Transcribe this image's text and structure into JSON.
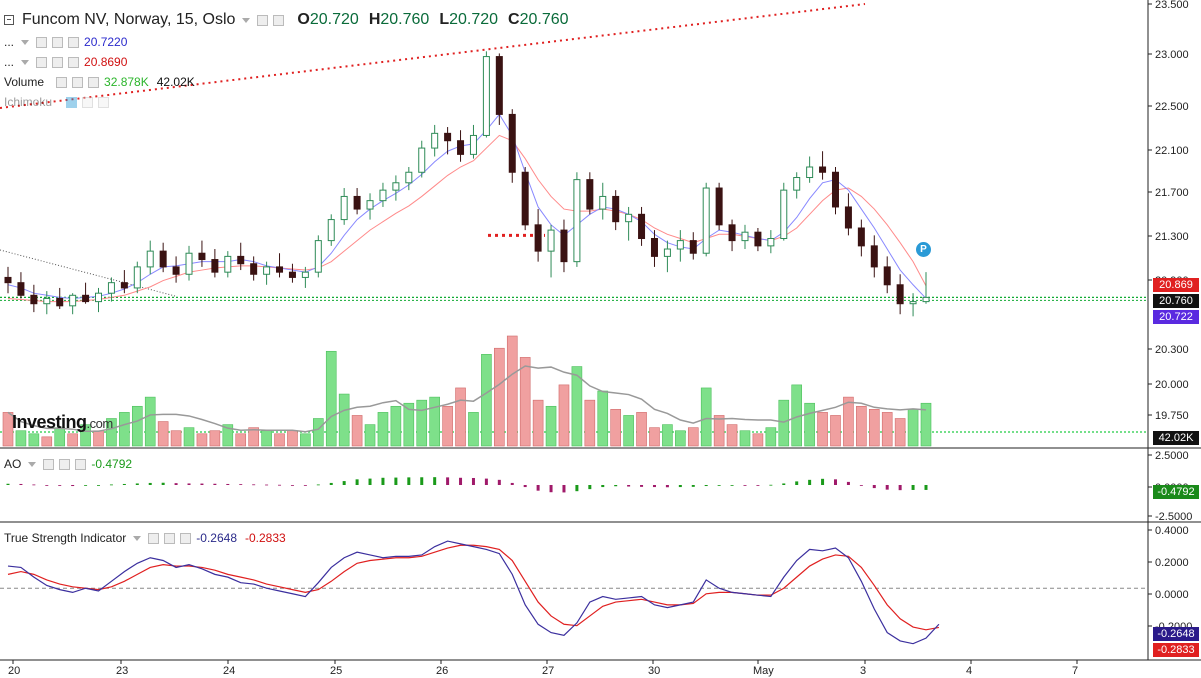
{
  "header": {
    "symbol": "Funcom NV, Norway, 15, Oslo",
    "open_label": "O",
    "open": "20.720",
    "high_label": "H",
    "high": "20.760",
    "low_label": "L",
    "low": "20.720",
    "close_label": "C",
    "close": "20.760"
  },
  "legend": {
    "ma1_name": "...",
    "ma1_value": "20.7220",
    "ma2_name": "...",
    "ma2_value": "20.8690",
    "volume_name": "Volume",
    "volume_value1": "32.878K",
    "volume_value2": "42.02K",
    "ichimoku_name": "Ichimoku",
    "ao_name": "AO",
    "ao_value": "-0.4792",
    "tsi_name": "True Strength Indicator",
    "tsi_value1": "-0.2648",
    "tsi_value2": "-0.2833"
  },
  "logo": {
    "text": "Investing",
    "suffix": ".com"
  },
  "marker": {
    "label": "P"
  },
  "price_tags": {
    "ma2": "20.869",
    "close": "20.760",
    "ma1": "20.722",
    "volume": "42.02K",
    "ao": "-0.4792",
    "tsi1": "-0.2648",
    "tsi2": "-0.2833"
  },
  "colors": {
    "up": "#2e8b57",
    "down": "#3a1212",
    "vol_up": "#7ee08a",
    "vol_down": "#f0a0a0",
    "ma_fast": "#8888ff",
    "ma_slow": "#ff8a8a",
    "tsi": "#3b2f9e",
    "tsi_signal": "#e02020",
    "ichimoku": "#e02020",
    "ao_up": "#1a9a1a",
    "ao_down": "#a01a6a"
  },
  "chart_data": [
    {
      "type": "candlestick",
      "title": "Funcom NV, Norway, 15, Oslo",
      "y_ticks": [
        "23.500",
        "23.000",
        "22.500",
        "22.100",
        "21.700",
        "21.300",
        "20.900",
        "20.300",
        "20.000",
        "19.750"
      ],
      "x_ticks": [
        "20",
        "23",
        "24",
        "25",
        "26",
        "27",
        "30",
        "May",
        "3",
        "4",
        "7"
      ],
      "ylim": [
        20.45,
        23.55
      ],
      "candles": [
        [
          20.95,
          21.05,
          20.8,
          20.9
        ],
        [
          20.9,
          21.0,
          20.75,
          20.78
        ],
        [
          20.78,
          20.88,
          20.62,
          20.7
        ],
        [
          20.7,
          20.82,
          20.6,
          20.75
        ],
        [
          20.75,
          20.85,
          20.65,
          20.68
        ],
        [
          20.68,
          20.8,
          20.6,
          20.78
        ],
        [
          20.78,
          20.9,
          20.7,
          20.72
        ],
        [
          20.72,
          20.85,
          20.62,
          20.8
        ],
        [
          20.8,
          20.95,
          20.72,
          20.9
        ],
        [
          20.9,
          21.02,
          20.8,
          20.85
        ],
        [
          20.85,
          21.1,
          20.8,
          21.05
        ],
        [
          21.05,
          21.3,
          20.98,
          21.2
        ],
        [
          21.2,
          21.28,
          21.0,
          21.05
        ],
        [
          21.05,
          21.15,
          20.9,
          20.98
        ],
        [
          20.98,
          21.25,
          20.92,
          21.18
        ],
        [
          21.18,
          21.3,
          21.05,
          21.12
        ],
        [
          21.12,
          21.22,
          20.95,
          21.0
        ],
        [
          21.0,
          21.2,
          20.95,
          21.15
        ],
        [
          21.15,
          21.28,
          21.02,
          21.08
        ],
        [
          21.08,
          21.15,
          20.92,
          20.98
        ],
        [
          20.98,
          21.1,
          20.88,
          21.05
        ],
        [
          21.05,
          21.18,
          20.95,
          21.0
        ],
        [
          21.0,
          21.08,
          20.9,
          20.95
        ],
        [
          20.95,
          21.05,
          20.85,
          21.0
        ],
        [
          21.0,
          21.35,
          20.95,
          21.3
        ],
        [
          21.3,
          21.55,
          21.25,
          21.5
        ],
        [
          21.5,
          21.8,
          21.45,
          21.72
        ],
        [
          21.72,
          21.8,
          21.55,
          21.6
        ],
        [
          21.6,
          21.75,
          21.5,
          21.68
        ],
        [
          21.68,
          21.85,
          21.62,
          21.78
        ],
        [
          21.78,
          21.92,
          21.68,
          21.85
        ],
        [
          21.85,
          22.0,
          21.78,
          21.95
        ],
        [
          21.95,
          22.25,
          21.9,
          22.18
        ],
        [
          22.18,
          22.4,
          22.1,
          22.32
        ],
        [
          22.32,
          22.38,
          22.12,
          22.25
        ],
        [
          22.25,
          22.35,
          22.05,
          22.12
        ],
        [
          22.12,
          22.4,
          22.08,
          22.3
        ],
        [
          22.3,
          23.1,
          22.28,
          23.05
        ],
        [
          23.05,
          23.08,
          22.4,
          22.5
        ],
        [
          22.5,
          22.55,
          21.85,
          21.95
        ],
        [
          21.95,
          22.0,
          21.4,
          21.45
        ],
        [
          21.45,
          21.6,
          21.1,
          21.2
        ],
        [
          21.2,
          21.45,
          20.95,
          21.4
        ],
        [
          21.4,
          21.5,
          21.0,
          21.1
        ],
        [
          21.1,
          21.95,
          21.05,
          21.88
        ],
        [
          21.88,
          21.95,
          21.55,
          21.6
        ],
        [
          21.6,
          21.85,
          21.5,
          21.72
        ],
        [
          21.72,
          21.78,
          21.4,
          21.48
        ],
        [
          21.48,
          21.62,
          21.3,
          21.55
        ],
        [
          21.55,
          21.62,
          21.25,
          21.32
        ],
        [
          21.32,
          21.4,
          21.05,
          21.15
        ],
        [
          21.15,
          21.3,
          21.0,
          21.22
        ],
        [
          21.22,
          21.4,
          21.1,
          21.3
        ],
        [
          21.3,
          21.38,
          21.12,
          21.18
        ],
        [
          21.18,
          21.85,
          21.15,
          21.8
        ],
        [
          21.8,
          21.85,
          21.4,
          21.45
        ],
        [
          21.45,
          21.5,
          21.2,
          21.3
        ],
        [
          21.3,
          21.45,
          21.22,
          21.38
        ],
        [
          21.38,
          21.42,
          21.2,
          21.25
        ],
        [
          21.25,
          21.4,
          21.18,
          21.32
        ],
        [
          21.32,
          21.85,
          21.3,
          21.78
        ],
        [
          21.78,
          21.95,
          21.7,
          21.9
        ],
        [
          21.9,
          22.1,
          21.85,
          22.0
        ],
        [
          22.0,
          22.15,
          21.88,
          21.95
        ],
        [
          21.95,
          22.0,
          21.55,
          21.62
        ],
        [
          21.62,
          21.75,
          21.35,
          21.42
        ],
        [
          21.42,
          21.5,
          21.15,
          21.25
        ],
        [
          21.25,
          21.35,
          20.95,
          21.05
        ],
        [
          21.05,
          21.15,
          20.8,
          20.88
        ],
        [
          20.88,
          20.98,
          20.6,
          20.7
        ],
        [
          20.7,
          20.8,
          20.58,
          20.72
        ],
        [
          20.72,
          21.0,
          20.7,
          20.76
        ]
      ],
      "ma_fast": [
        20.88,
        20.85,
        20.8,
        20.78,
        20.76,
        20.75,
        20.76,
        20.77,
        20.8,
        20.84,
        20.9,
        20.98,
        21.05,
        21.06,
        21.08,
        21.1,
        21.1,
        21.1,
        21.12,
        21.1,
        21.06,
        21.04,
        21.02,
        21.0,
        21.05,
        21.18,
        21.35,
        21.5,
        21.6,
        21.68,
        21.75,
        21.83,
        21.93,
        22.05,
        22.15,
        22.2,
        22.22,
        22.35,
        22.5,
        22.3,
        21.95,
        21.62,
        21.45,
        21.35,
        21.45,
        21.55,
        21.62,
        21.6,
        21.55,
        21.48,
        21.36,
        21.28,
        21.24,
        21.22,
        21.32,
        21.4,
        21.38,
        21.35,
        21.32,
        21.3,
        21.38,
        21.52,
        21.7,
        21.85,
        21.88,
        21.78,
        21.6,
        21.42,
        21.22,
        21.02,
        20.88,
        20.75
      ],
      "ma_slow": [
        20.75,
        20.74,
        20.73,
        20.72,
        20.72,
        20.72,
        20.73,
        20.74,
        20.76,
        20.78,
        20.82,
        20.86,
        20.92,
        20.96,
        21.0,
        21.02,
        21.04,
        21.05,
        21.06,
        21.06,
        21.05,
        21.04,
        21.03,
        21.02,
        21.04,
        21.1,
        21.2,
        21.3,
        21.4,
        21.48,
        21.56,
        21.63,
        21.72,
        21.82,
        21.92,
        22.0,
        22.06,
        22.18,
        22.3,
        22.25,
        22.08,
        21.88,
        21.72,
        21.6,
        21.58,
        21.58,
        21.6,
        21.58,
        21.55,
        21.5,
        21.42,
        21.36,
        21.32,
        21.28,
        21.32,
        21.36,
        21.36,
        21.34,
        21.32,
        21.3,
        21.34,
        21.42,
        21.55,
        21.68,
        21.78,
        21.8,
        21.72,
        21.6,
        21.45,
        21.28,
        21.1,
        20.87
      ],
      "support_levels": [
        20.76,
        21.35
      ]
    },
    {
      "type": "bar",
      "title": "Volume",
      "values": [
        22,
        10,
        8,
        6,
        12,
        8,
        14,
        10,
        18,
        22,
        26,
        32,
        16,
        10,
        12,
        8,
        10,
        14,
        8,
        12,
        10,
        8,
        10,
        8,
        18,
        62,
        34,
        20,
        14,
        22,
        26,
        28,
        30,
        32,
        26,
        38,
        22,
        60,
        64,
        72,
        58,
        30,
        26,
        40,
        52,
        30,
        36,
        24,
        20,
        22,
        12,
        14,
        10,
        12,
        38,
        20,
        14,
        10,
        8,
        12,
        30,
        40,
        28,
        22,
        20,
        32,
        26,
        24,
        22,
        18,
        24,
        28
      ],
      "direction": [
        0,
        1,
        1,
        0,
        1,
        0,
        1,
        0,
        1,
        1,
        1,
        1,
        0,
        0,
        1,
        0,
        0,
        1,
        0,
        0,
        1,
        0,
        0,
        1,
        1,
        1,
        1,
        0,
        1,
        1,
        1,
        1,
        1,
        1,
        0,
        0,
        1,
        1,
        0,
        0,
        0,
        0,
        1,
        0,
        1,
        0,
        1,
        0,
        1,
        0,
        0,
        1,
        1,
        0,
        1,
        0,
        0,
        1,
        0,
        1,
        1,
        1,
        1,
        0,
        0,
        0,
        0,
        0,
        0,
        0,
        1,
        1
      ]
    },
    {
      "type": "bar",
      "title": "AO",
      "y_ticks": [
        "2.5000",
        "0.0000",
        "-2.5000"
      ],
      "ylim": [
        -3.2,
        3.2
      ],
      "values": [
        0.12,
        0.1,
        0.05,
        0,
        -0.08,
        -0.1,
        -0.05,
        0.0,
        0.05,
        0.1,
        0.15,
        0.2,
        0.22,
        0.18,
        0.15,
        0.14,
        0.12,
        0.1,
        0.08,
        0.06,
        0.04,
        0.02,
        0.0,
        -0.02,
        0.05,
        0.2,
        0.38,
        0.55,
        0.62,
        0.7,
        0.72,
        0.74,
        0.75,
        0.76,
        0.74,
        0.7,
        0.68,
        0.62,
        0.5,
        0.2,
        -0.2,
        -0.55,
        -0.7,
        -0.72,
        -0.6,
        -0.4,
        -0.2,
        -0.12,
        -0.15,
        -0.18,
        -0.2,
        -0.22,
        -0.2,
        -0.18,
        -0.1,
        -0.05,
        0,
        -0.04,
        -0.06,
        0.02,
        0.15,
        0.35,
        0.5,
        0.6,
        0.55,
        0.3,
        -0.05,
        -0.3,
        -0.45,
        -0.5,
        -0.48,
        -0.4792
      ]
    },
    {
      "type": "line",
      "title": "True Strength Indicator",
      "y_ticks": [
        "0.4000",
        "0.2000",
        "0.0000",
        "-0.2000",
        "-0.4000"
      ],
      "ylim": [
        -0.46,
        0.42
      ],
      "tsi": [
        0.16,
        0.15,
        0.08,
        0.02,
        -0.01,
        -0.03,
        0.0,
        -0.02,
        0.05,
        0.12,
        0.18,
        0.22,
        0.2,
        0.15,
        0.17,
        0.14,
        0.1,
        0.08,
        0.04,
        0.03,
        0.0,
        -0.02,
        -0.04,
        -0.06,
        0.04,
        0.15,
        0.22,
        0.26,
        0.24,
        0.22,
        0.23,
        0.23,
        0.24,
        0.3,
        0.34,
        0.32,
        0.3,
        0.28,
        0.25,
        0.1,
        -0.12,
        -0.26,
        -0.32,
        -0.34,
        -0.25,
        -0.1,
        -0.06,
        -0.08,
        -0.07,
        -0.06,
        -0.12,
        -0.14,
        -0.12,
        -0.1,
        0.06,
        0.0,
        -0.03,
        -0.04,
        -0.05,
        -0.06,
        0.08,
        0.2,
        0.28,
        0.27,
        0.29,
        0.22,
        0.05,
        -0.15,
        -0.32,
        -0.38,
        -0.4,
        -0.36,
        -0.26
      ],
      "signal": [
        0.1,
        0.12,
        0.1,
        0.06,
        0.03,
        0.01,
        0.0,
        -0.01,
        0.01,
        0.05,
        0.1,
        0.15,
        0.17,
        0.16,
        0.16,
        0.15,
        0.13,
        0.1,
        0.08,
        0.06,
        0.03,
        0.01,
        -0.01,
        -0.03,
        -0.01,
        0.05,
        0.12,
        0.18,
        0.2,
        0.21,
        0.22,
        0.22,
        0.23,
        0.26,
        0.29,
        0.31,
        0.31,
        0.3,
        0.28,
        0.2,
        0.05,
        -0.1,
        -0.2,
        -0.26,
        -0.27,
        -0.2,
        -0.13,
        -0.1,
        -0.09,
        -0.08,
        -0.1,
        -0.12,
        -0.12,
        -0.11,
        -0.04,
        -0.03,
        -0.03,
        -0.04,
        -0.05,
        -0.05,
        0.0,
        0.08,
        0.16,
        0.21,
        0.24,
        0.23,
        0.15,
        0.02,
        -0.12,
        -0.22,
        -0.28,
        -0.3,
        -0.283
      ]
    }
  ]
}
